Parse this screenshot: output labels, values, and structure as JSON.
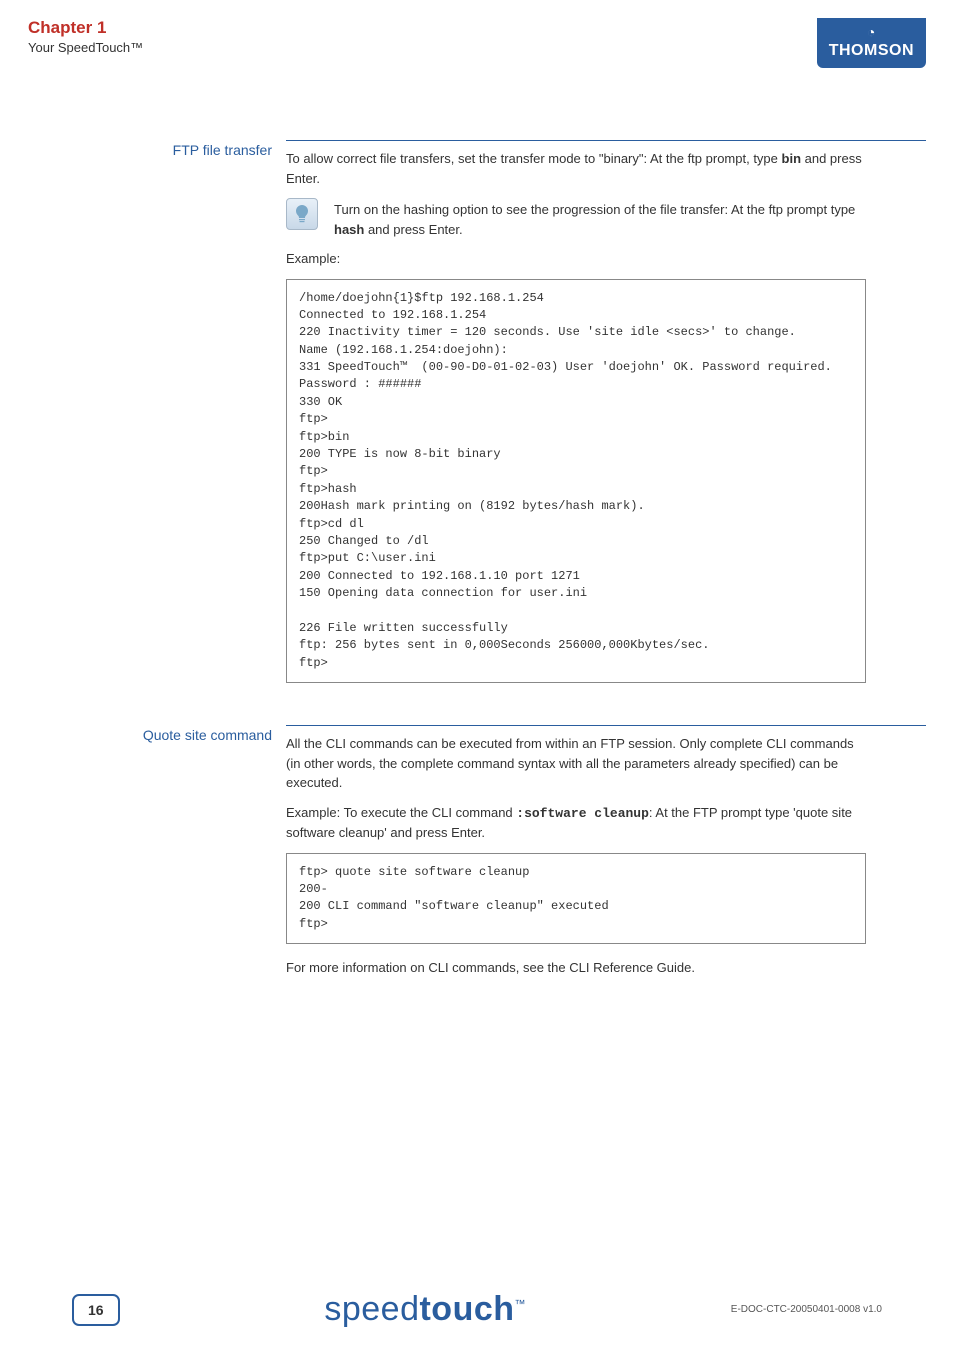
{
  "header": {
    "chapter": "Chapter 1",
    "subtitle": "Your SpeedTouch™",
    "brand": "THOMSON"
  },
  "sections": {
    "ftp": {
      "label": "FTP file transfer",
      "intro_pre": "To allow correct file transfers, set the transfer mode to \"binary\": At the ftp prompt, type ",
      "intro_cmd": "bin",
      "intro_post": " and press Enter.",
      "tip_pre": "Turn on the hashing option to see the progression of the file transfer: At the ftp prompt type ",
      "tip_cmd": "hash",
      "tip_post": " and press Enter.",
      "example_label": "Example:",
      "code": "/home/doejohn{1}$ftp 192.168.1.254\nConnected to 192.168.1.254\n220 Inactivity timer = 120 seconds. Use 'site idle <secs>' to change.\nName (192.168.1.254:doejohn):\n331 SpeedTouch™  (00-90-D0-01-02-03) User 'doejohn' OK. Password required.\nPassword : ######\n330 OK\nftp>\nftp>bin\n200 TYPE is now 8-bit binary\nftp>\nftp>hash\n200Hash mark printing on (8192 bytes/hash mark).\nftp>cd dl\n250 Changed to /dl\nftp>put C:\\user.ini\n200 Connected to 192.168.1.10 port 1271\n150 Opening data connection for user.ini\n\n226 File written successfully\nftp: 256 bytes sent in 0,000Seconds 256000,000Kbytes/sec.\nftp>"
    },
    "quote": {
      "label": "Quote site command",
      "para1": "All the CLI commands can be executed from within an FTP session. Only complete CLI commands (in other words, the complete command syntax with all the parameters already specified) can be executed.",
      "para2_pre": "Example: To execute the CLI command ",
      "para2_cmd": ":software cleanup",
      "para2_post": ": At the FTP prompt type 'quote site software cleanup' and press Enter.",
      "code": "ftp> quote site software cleanup\n200-\n200 CLI command \"software cleanup\" executed\nftp>",
      "para3": "For more information on CLI commands, see the CLI Reference Guide."
    }
  },
  "footer": {
    "page": "16",
    "logo_light": "speed",
    "logo_bold": "touch",
    "logo_tm": "™",
    "docid": "E-DOC-CTC-20050401-0008 v1.0"
  }
}
